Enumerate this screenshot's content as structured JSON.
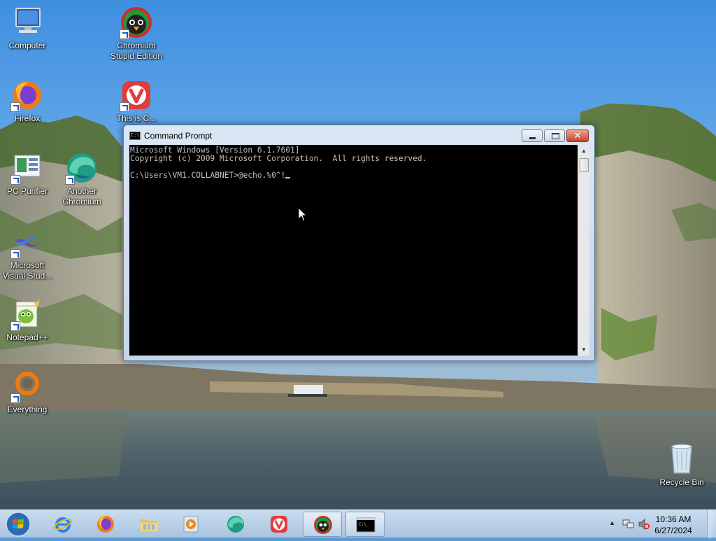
{
  "desktop": {
    "icons": [
      {
        "label": "Computer",
        "icon": "computer-icon",
        "shortcut": false
      },
      {
        "label": "Chromium Stupid Edition",
        "icon": "chromium-stupid-icon",
        "shortcut": true
      },
      {
        "label": "Firefox",
        "icon": "firefox-icon",
        "shortcut": true
      },
      {
        "label": "This is C...",
        "icon": "vivaldi-icon",
        "shortcut": true
      },
      {
        "label": "PC Purifier",
        "icon": "pc-purifier-icon",
        "shortcut": true
      },
      {
        "label": "Another Chromium",
        "icon": "another-chromium-icon",
        "shortcut": true
      },
      {
        "label": "Microsoft Visual Stud...",
        "icon": "visual-studio-icon",
        "shortcut": true
      },
      {
        "label": "Notepad++",
        "icon": "notepadpp-icon",
        "shortcut": true
      },
      {
        "label": "Everything",
        "icon": "everything-icon",
        "shortcut": true
      },
      {
        "label": "Recycle Bin",
        "icon": "recycle-bin-icon",
        "shortcut": false
      }
    ]
  },
  "cmd_window": {
    "title": "Command Prompt",
    "console_lines": [
      "Microsoft Windows [Version 6.1.7601]",
      "Copyright (c) 2009 Microsoft Corporation.  All rights reserved.",
      "",
      "C:\\Users\\VM1.COLLABNET>@echo.%0^!"
    ],
    "colors": {
      "background": "#000000",
      "text": "#c0c0c0"
    }
  },
  "taskbar": {
    "pinned": [
      {
        "name": "internet-explorer",
        "icon": "internet-explorer-icon"
      },
      {
        "name": "firefox",
        "icon": "firefox-icon"
      },
      {
        "name": "file-explorer",
        "icon": "folder-icon"
      },
      {
        "name": "media-player",
        "icon": "media-player-icon"
      },
      {
        "name": "another-chromium",
        "icon": "another-chromium-icon"
      },
      {
        "name": "vivaldi",
        "icon": "vivaldi-icon"
      },
      {
        "name": "chromium-stupid",
        "icon": "chromium-stupid-icon"
      },
      {
        "name": "command-prompt",
        "icon": "cmd-icon",
        "active": true
      }
    ],
    "tray": {
      "time": "10:36 AM",
      "date": "6/27/2024",
      "icons": [
        "show-hidden-icons-arrow",
        "network-icon",
        "volume-muted-icon"
      ]
    }
  }
}
